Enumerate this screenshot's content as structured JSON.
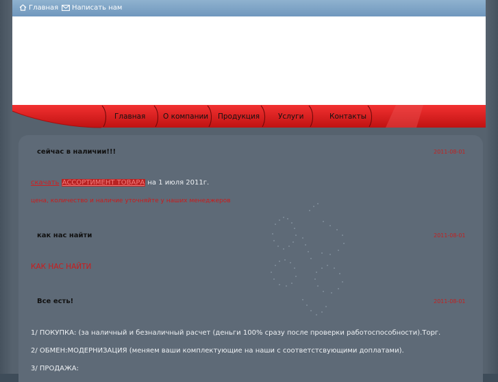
{
  "topbar": {
    "home_label": "Главная",
    "write_label": "Написать нам"
  },
  "nav": {
    "items": [
      "Главная",
      "О компании",
      "Продукция",
      "Услуги",
      "Контакты"
    ]
  },
  "posts": [
    {
      "title": "сейчас в наличии!!!",
      "date": "2011-08-01",
      "line1_link": "скачать",
      "line1_highlight": "АССОРТИМЕНТ ТОВАРА",
      "line1_rest": " на  1  июля  2011г.",
      "line2": "цена, количество и наличие уточняйте у наших менеджеров"
    },
    {
      "title": "как нас найти",
      "date": "2011-08-01",
      "body": "КАК НАС НАЙТИ"
    },
    {
      "title": "Все есть!",
      "date": "2011-08-01",
      "lines": [
        "1/ ПОКУПКА: (за наличный и безналичный расчет (деньги 100% сразу после проверки работоспособности).Торг.",
        "2/ ОБМЕН:МОДЕРНИЗАЦИЯ (меняем ваши комплектующие на наши с соответстсвующими доплатами).",
        "3/ ПРОДАЖА:"
      ]
    }
  ],
  "colors": {
    "topbar": "#7aa0c4",
    "nav_red": "#e01e1e",
    "content_bg": "#5e6a77",
    "accent_red": "#cc1b1b"
  }
}
